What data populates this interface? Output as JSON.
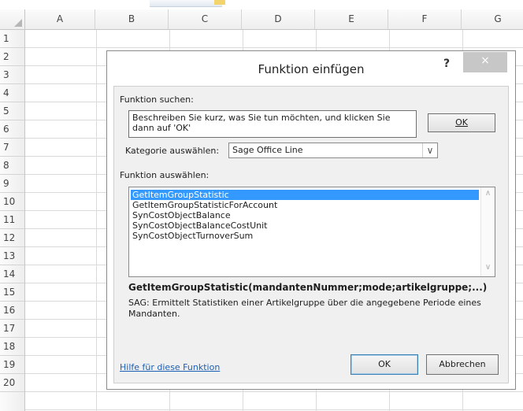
{
  "spreadsheet": {
    "columns": [
      "A",
      "B",
      "C",
      "D",
      "E",
      "F",
      "G"
    ],
    "rows": [
      "1",
      "2",
      "3",
      "4",
      "5",
      "6",
      "7",
      "8",
      "9",
      "10",
      "11",
      "12",
      "13",
      "14",
      "15",
      "16",
      "17",
      "18",
      "19",
      "20"
    ]
  },
  "dialog": {
    "title": "Funktion einfügen",
    "help_label": "?",
    "close_label": "×",
    "search_label": "Funktion suchen:",
    "search_value": "Beschreiben Sie kurz, was Sie tun möchten, und klicken Sie dann auf 'OK'",
    "go_label": "OK",
    "category_label": "Kategorie auswählen:",
    "category_value": "Sage Office Line",
    "select_label": "Funktion auswählen:",
    "functions": [
      "GetItemGroupStatistic",
      "GetItemGroupStatisticForAccount",
      "SynCostObjectBalance",
      "SynCostObjectBalanceCostUnit",
      "SynCostObjectTurnoverSum"
    ],
    "selected_function": "GetItemGroupStatistic",
    "signature": "GetItemGroupStatistic(mandantenNummer;mode;artikelgruppe;...)",
    "description": "SAG: Ermittelt Statistiken einer Artikelgruppe über die angegebene Periode eines Mandanten.",
    "help_link": "Hilfe für diese Funktion",
    "ok_label": "OK",
    "cancel_label": "Abbrechen"
  },
  "colors": {
    "selection": "#3399ff",
    "link": "#1a5fb4",
    "close_button": "#c7c7c7"
  }
}
